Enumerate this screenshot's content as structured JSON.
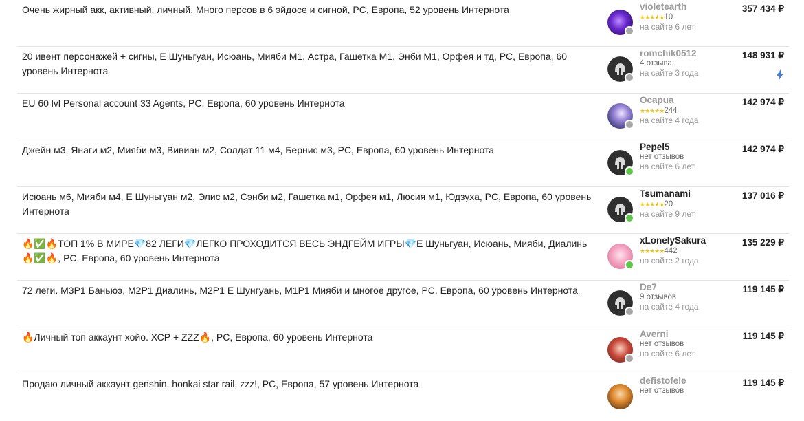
{
  "colors": {
    "star": "#f2c11b",
    "online": "#5fc74b",
    "offline": "#a8a8a8",
    "bolt": "#4a7fd8",
    "divider": "#e3e3e3"
  },
  "listings": [
    {
      "description": "Очень жирный акк, активный, личный. Много персов в 6 эйдосе и сигной, PC, Европа, 52 уровень Интернота",
      "seller": "violetearth",
      "rating_stars": "★★★★★",
      "reviews": "10",
      "since": "на сайте 6 лет",
      "price": "357 434 ₽",
      "status": "offline"
    },
    {
      "description": "20 ивент персонажей + сигны, Е Шуньгуан, Исюань, Мияби М1, Астра, Гашетка М1, Энби М1, Орфея и тд, PC, Европа, 60 уровень Интернота",
      "seller": "romchik0512",
      "reviews_text": "4 отзыва",
      "since": "на сайте 3 года",
      "price": "148 931 ₽",
      "status": "offline",
      "instant_icon": "lightning-icon"
    },
    {
      "description": "EU 60 lvl Personal account 33 Agents, PC, Европа, 60 уровень Интернота",
      "seller": "Ocapua",
      "rating_stars": "★★★★★",
      "reviews": "244",
      "since": "на сайте 4 года",
      "price": "142 974 ₽",
      "status": "offline"
    },
    {
      "description": "Джейн м3, Янаги м2, Мияби м3, Вивиан м2, Солдат 11 м4, Бернис м3, PC, Европа, 60 уровень Интернота",
      "seller": "Pepel5",
      "reviews_text": "нет отзывов",
      "since": "на сайте 6 лет",
      "price": "142 974 ₽",
      "status": "online"
    },
    {
      "description": "Исюань м6, Мияби м4, Е Шуньгуан м2, Элис м2, Сэнби м2, Гашетка м1, Орфея м1, Люсия м1, Юдзуха, PC, Европа, 60 уровень Интернота",
      "seller": "Tsumanami",
      "rating_stars": "★★★★★",
      "reviews": "20",
      "since": "на сайте 9 лет",
      "price": "137 016 ₽",
      "status": "online"
    },
    {
      "description": "🔥✅🔥ТОП 1% В МИРЕ💎82 ЛЕГИ💎ЛЕГКО ПРОХОДИТСЯ ВЕСЬ ЭНДГЕЙМ ИГРЫ💎Е Шуньгуан, Исюань, Мияби, Диалинь 🔥✅🔥, PC, Европа, 60 уровень Интернота",
      "seller": "xLonelySakura",
      "rating_stars": "★★★★★",
      "reviews": "442",
      "since": "на сайте 2 года",
      "price": "135 229 ₽",
      "status": "online"
    },
    {
      "description": "72 леги. М3Р1 Баньюэ, М2Р1 Диалинь, М2Р1 Е Шунгуань, М1Р1 Мияби и многое другое, PC, Европа, 60 уровень Интернота",
      "seller": "De7",
      "reviews_text": "9 отзывов",
      "since": "на сайте 4 года",
      "price": "119 145 ₽",
      "status": "offline"
    },
    {
      "description": "🔥Личный топ аккаунт хойо. ХСР + ZZZ🔥, PC, Европа, 60 уровень Интернота",
      "seller": "Averni",
      "reviews_text": "нет отзывов",
      "since": "на сайте 6 лет",
      "price": "119 145 ₽",
      "status": "offline"
    },
    {
      "description": "Продаю личный аккаунт genshin, honkai star rail, zzz!, PC, Европа, 57 уровень Интернота",
      "seller": "defistofele",
      "reviews_text": "нет отзывов",
      "since": "",
      "price": "119 145 ₽",
      "status": "offline"
    }
  ]
}
